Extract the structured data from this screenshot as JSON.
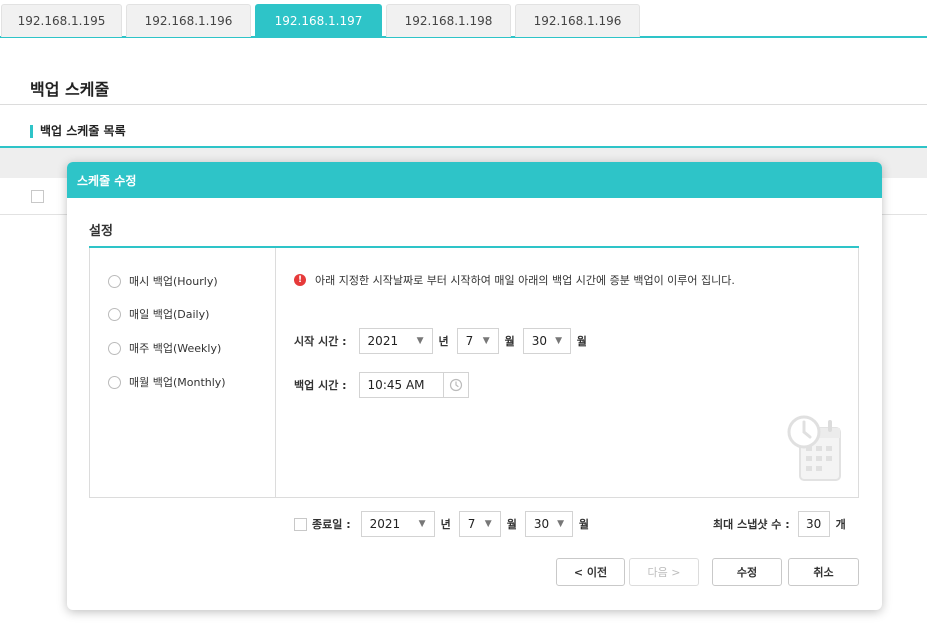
{
  "tabs": [
    {
      "label": "192.168.1.195",
      "active": false
    },
    {
      "label": "192.168.1.196",
      "active": false
    },
    {
      "label": "192.168.1.197",
      "active": true
    },
    {
      "label": "192.168.1.198",
      "active": false
    },
    {
      "label": "192.168.1.196",
      "active": false
    }
  ],
  "page": {
    "title": "백업 스케줄",
    "section_title": "백업 스케줄 목록"
  },
  "modal": {
    "title": "스케줄 수정",
    "section_title": "설정",
    "radios": [
      {
        "label": "매시 백업(Hourly)",
        "checked": false
      },
      {
        "label": "매일 백업(Daily)",
        "checked": false
      },
      {
        "label": "매주 백업(Weekly)",
        "checked": false
      },
      {
        "label": "매월 백업(Monthly)",
        "checked": false
      }
    ],
    "notice": "아래 지정한 시작날짜로 부터 시작하여 매일 아래의 백업 시간에 증분 백업이 이루어 집니다.",
    "start": {
      "label": "시작 시간 :",
      "year": "2021",
      "year_unit": "년",
      "month": "7",
      "month_unit": "월",
      "day": "30",
      "day_unit": "월"
    },
    "backup_time": {
      "label": "백업 시간 :",
      "value": "10:45 AM"
    },
    "end": {
      "label": "종료일 :",
      "year": "2021",
      "year_unit": "년",
      "month": "7",
      "month_unit": "월",
      "day": "30",
      "day_unit": "월"
    },
    "snapshot": {
      "label": "최대 스냅샷 수 :",
      "value": "30",
      "unit": "개"
    },
    "buttons": {
      "prev": "< 이전",
      "next": "다음 >",
      "edit": "수정",
      "cancel": "취소"
    }
  },
  "colors": {
    "accent": "#2ec4c8",
    "warning": "#e63a3a"
  },
  "icons": {
    "warning": "warning-icon",
    "clock": "clock-icon",
    "calendar": "calendar-clock-icon",
    "dropdown": "chevron-down-icon"
  }
}
